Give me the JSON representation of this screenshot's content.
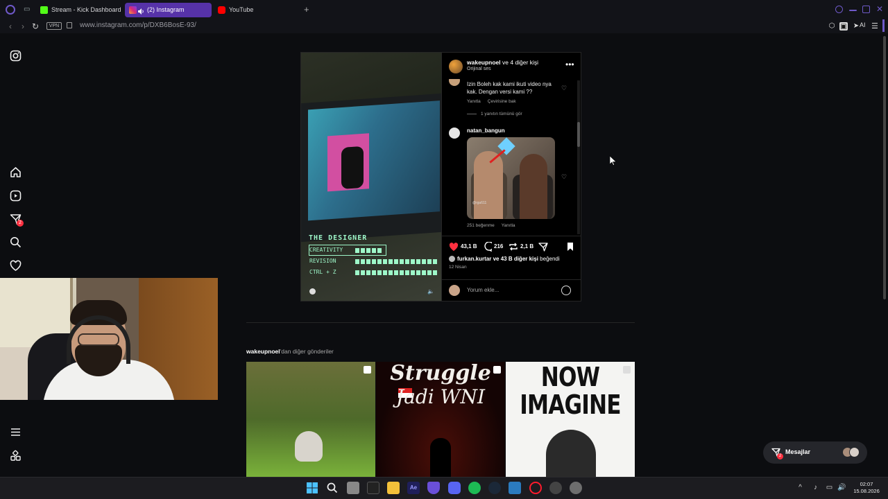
{
  "browser": {
    "tabs": [
      {
        "label": "Stream - Kick Dashboard",
        "active": false
      },
      {
        "label": "(2) Instagram",
        "active": true
      },
      {
        "label": "YouTube",
        "active": false
      }
    ],
    "vpn_label": "VPN",
    "url": "www.instagram.com/p/DXB6BosE-93/",
    "ai_label": "AI"
  },
  "sidebar": {
    "items": [
      {
        "icon": "instagram-icon"
      },
      {
        "icon": "home-icon"
      },
      {
        "icon": "reels-icon"
      },
      {
        "icon": "direct-icon",
        "badge": "2"
      },
      {
        "icon": "search-icon"
      },
      {
        "icon": "heart-icon"
      },
      {
        "icon": "menu-icon"
      },
      {
        "icon": "apps-icon"
      }
    ]
  },
  "media": {
    "title": "THE DESIGNER",
    "stats": [
      {
        "label": "CREATIVITY",
        "bars": 5
      },
      {
        "label": "REVISION",
        "bars": 15
      },
      {
        "label": "CTRL + Z",
        "bars": 15
      }
    ]
  },
  "post": {
    "author": "wakeupnoel",
    "author_suffix": " ve 4 diğer kişi",
    "audio": "Orijinal ses",
    "comments": [
      {
        "text": "Izin Boleh kak kami ikuti video nya kak. Dengan versi kami ??",
        "reply": "Yanıtla",
        "translate": "Çevirisine bak"
      },
      {
        "view_replies": "1 yanıtın tümünü gör"
      },
      {
        "user": "natan_bangun",
        "image_watermark": "@rgu611",
        "likes": "251 beğenme",
        "reply": "Yanıtla"
      }
    ],
    "like_count": "43,1 B",
    "comment_count": "216",
    "repost_count": "2,1 B",
    "liked_by_user": "furkan.kurtar",
    "liked_by_rest": " ve 43 B diğer kişi",
    "liked_by_suffix": " beğendi",
    "date": "12 Nisan",
    "comment_placeholder": "Yorum ekle..."
  },
  "more_posts": {
    "author": "wakeupnoel",
    "suffix": "'dan diğer gönderiler",
    "thumbs": [
      {
        "text": ""
      },
      {
        "title": "Struggle",
        "subtitle": "Jadi WNI"
      },
      {
        "title": "NOW IMAGINE"
      }
    ]
  },
  "messages": {
    "label": "Mesajlar",
    "badge": "2"
  },
  "taskbar": {
    "time": "02:07",
    "date": "15.08.2026",
    "ae_label": "Ae"
  },
  "colors": {
    "accent": "#5632a8",
    "notification": "#ff3040",
    "like": "#ff3040"
  }
}
